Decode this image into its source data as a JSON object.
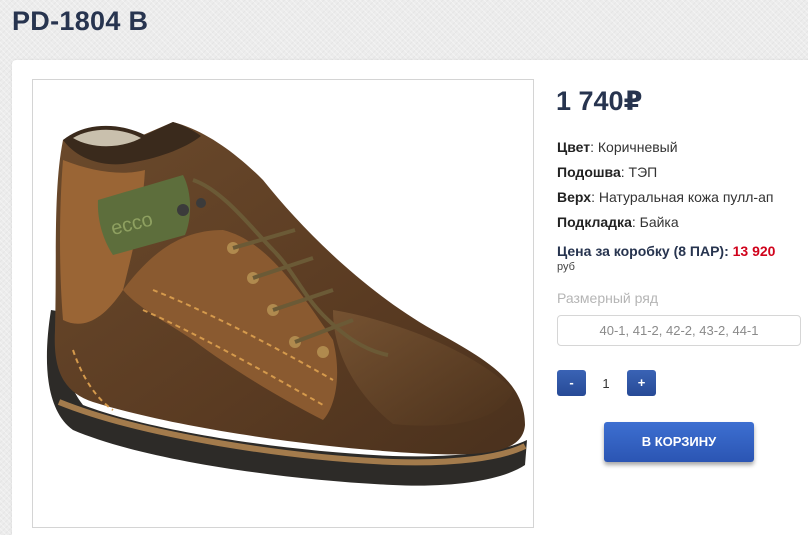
{
  "product": {
    "title": "PD-1804 B",
    "price": "1 740₽",
    "specs": [
      {
        "label": "Цвет",
        "value": ": Коричневый"
      },
      {
        "label": "Подошва",
        "value": ": ТЭП"
      },
      {
        "label": "Верх",
        "value": ": Натуральная кожа пулл-ап"
      },
      {
        "label": "Подкладка",
        "value": ": Байка"
      }
    ],
    "box_price_label": "Цена за коробку (8 ПАР): ",
    "box_price_value": "13 920",
    "box_price_currency": "руб",
    "size_label": "Размерный ряд",
    "size_value": "40-1, 41-2, 42-2, 43-2, 44-1",
    "logo_text": "ecco"
  },
  "cart": {
    "minus_label": "-",
    "quantity": "1",
    "plus_label": "+",
    "add_label": "В КОРЗИНУ"
  },
  "colors": {
    "accent": "#2b55b3",
    "title": "#27344f",
    "price_red": "#d0021b"
  }
}
